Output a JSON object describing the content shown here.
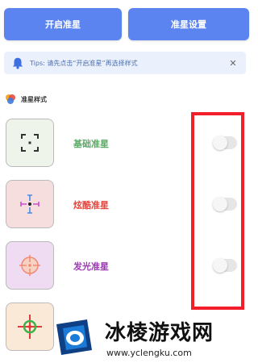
{
  "top_buttons": {
    "open": "开启准星",
    "settings": "准星设置"
  },
  "tips": {
    "text": "Tips: 请先点击“开启准星”再选择样式",
    "close": "✕"
  },
  "section": {
    "title": "准星样式"
  },
  "items": [
    {
      "label": "基础准星",
      "color": "#5aaa64",
      "thumb_bg": "#eef4ea",
      "enabled": false
    },
    {
      "label": "炫酷准星",
      "color": "#e3463c",
      "thumb_bg": "#f7dede",
      "enabled": false
    },
    {
      "label": "发光准星",
      "color": "#9a3ab0",
      "thumb_bg": "#efdcf3",
      "enabled": false
    },
    {
      "label": "",
      "color": "#e3463c",
      "thumb_bg": "#fbe9d8",
      "enabled": false
    }
  ],
  "watermark": {
    "title": "冰棱游戏网",
    "url": "www.yclengku.com"
  },
  "colors": {
    "primary": "#5b84f0",
    "highlight": "#f21f2b",
    "tips_bg": "#eaf1fd"
  }
}
